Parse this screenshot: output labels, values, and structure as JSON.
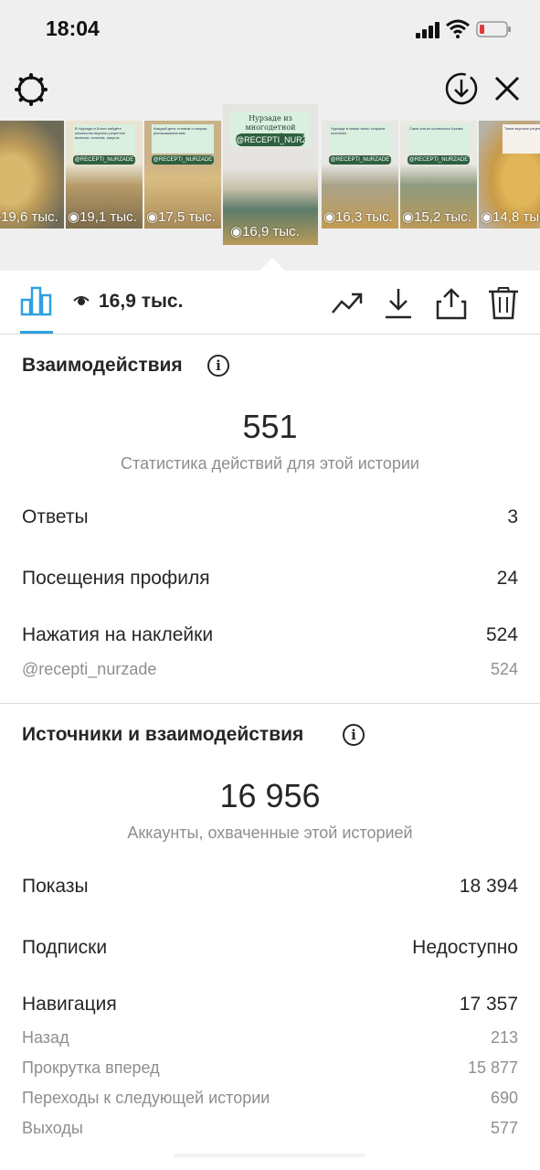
{
  "status_bar": {
    "time": "18:04"
  },
  "thumbnails": [
    {
      "views": "19,6 тыс.",
      "card_text": "",
      "tag": ""
    },
    {
      "views": "19,1 тыс.",
      "card_text": "В Нурзаде в Блоге найдёте множество вкусных рецептов выпечки, салатов, закусок",
      "tag": "@RECEPTI_NURZADE"
    },
    {
      "views": "17,5 тыс.",
      "card_text": "Каждый день готовим и творим, рассказываем вам",
      "tag": "@RECEPTI_NURZADE"
    },
    {
      "views": "16,9 тыс.",
      "card_text": "Нурзаде из многодетной семьи, где было 7 детей!",
      "tag": "@RECEPTI_NURZADE",
      "selected": true
    },
    {
      "views": "16,3 тыс.",
      "card_text": "Нурзаде в семье свято старших почитают",
      "tag": "@RECEPTI_NURZADE"
    },
    {
      "views": "15,2 тыс.",
      "card_text": "Сама она из солнечного Крыма",
      "tag": "@RECEPTI_NURZADE"
    },
    {
      "views": "14,8 тыс.",
      "card_text": "Такие вкусные рецепты",
      "tag": ""
    }
  ],
  "tab_bar": {
    "views_total": "16,9 тыс."
  },
  "interactions": {
    "title": "Взаимодействия",
    "info_glyph": "i",
    "total": "551",
    "subtitle": "Статистика действий для этой истории",
    "rows": [
      {
        "label": "Ответы",
        "value": "3"
      },
      {
        "label": "Посещения профиля",
        "value": "24"
      },
      {
        "label": "Нажатия на наклейки",
        "value": "524"
      }
    ],
    "sticker_row": {
      "label": "@recepti_nurzade",
      "value": "524"
    }
  },
  "discovery": {
    "title": "Источники и взаимодействия",
    "info_glyph": "i",
    "total": "16 956",
    "subtitle": "Аккаунты, охваченные этой историей",
    "rows": [
      {
        "label": "Показы",
        "value": "18 394"
      },
      {
        "label": "Подписки",
        "value": "Недоступно"
      },
      {
        "label": "Навигация",
        "value": "17 357"
      }
    ],
    "nav_rows": [
      {
        "label": "Назад",
        "value": "213"
      },
      {
        "label": "Прокрутка вперед",
        "value": "15 877"
      },
      {
        "label": "Переходы к следующей истории",
        "value": "690"
      },
      {
        "label": "Выходы",
        "value": "577"
      }
    ]
  },
  "colors": {
    "accent": "#2fa1e0",
    "text": "#262626",
    "muted": "#8e8e8e",
    "topzone": "#efefef",
    "battery_low": "#e0393e",
    "tag_green": "#2e6040"
  },
  "icons": [
    "gear-icon",
    "download-circle-icon",
    "close-icon",
    "bar-chart-icon",
    "eye-icon",
    "trend-icon",
    "download-icon",
    "share-icon",
    "trash-icon",
    "info-icon"
  ]
}
